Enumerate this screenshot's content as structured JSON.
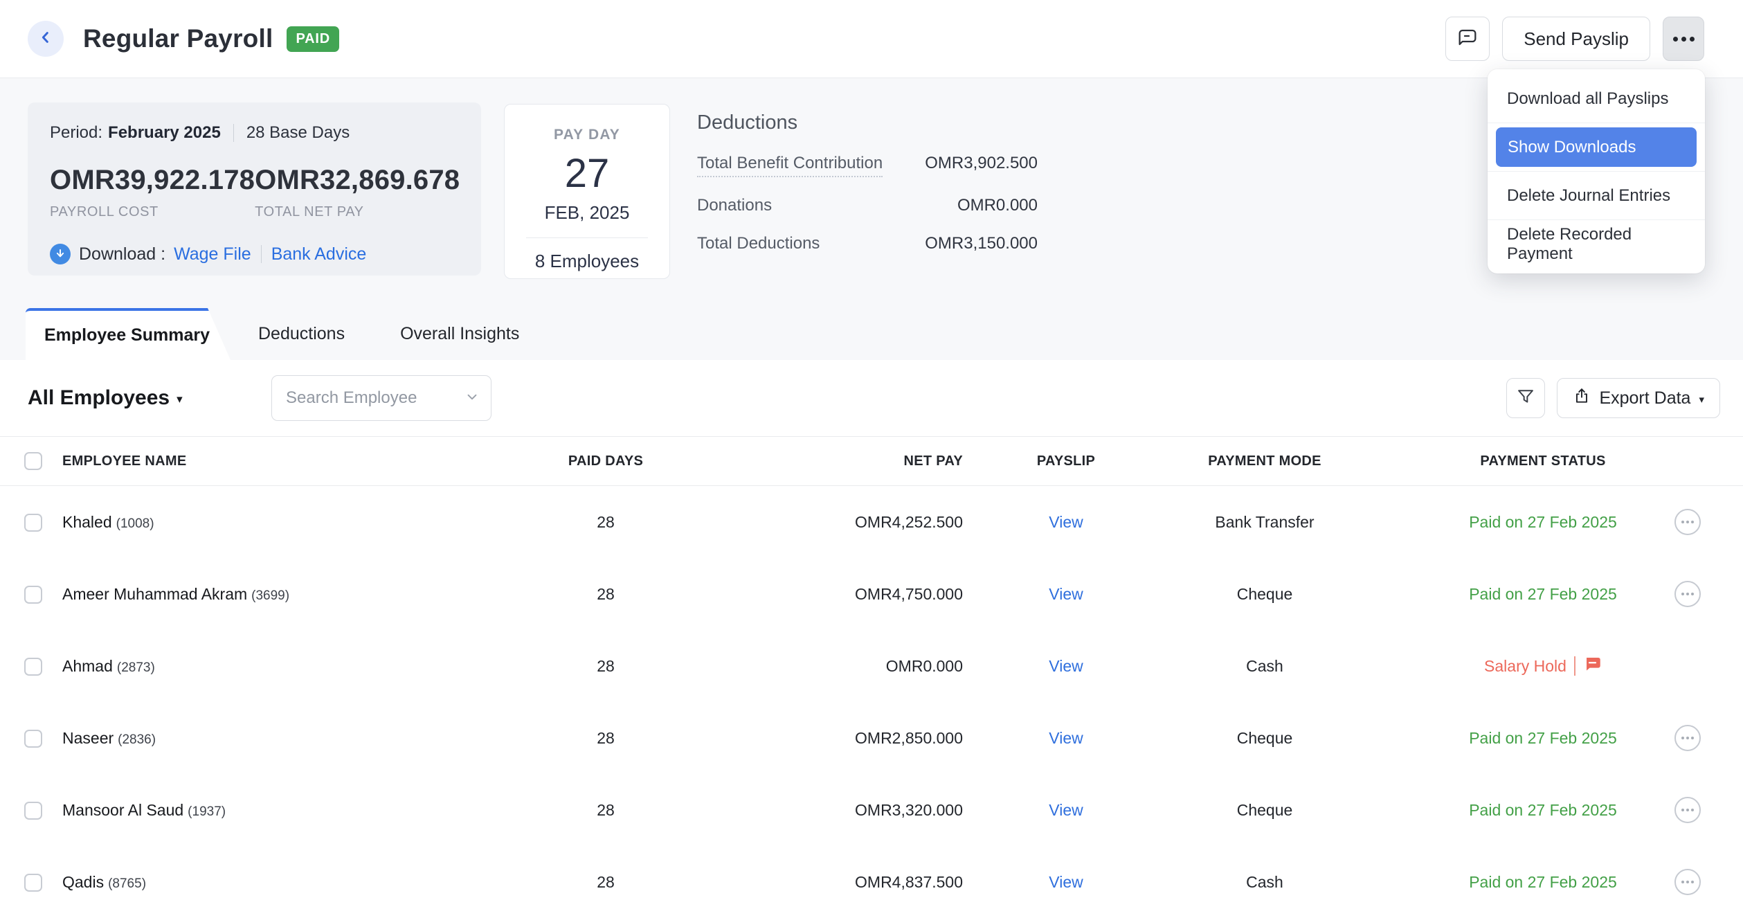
{
  "topbar": {
    "title": "Regular Payroll",
    "status_badge": "PAID",
    "send_payslip_label": "Send Payslip"
  },
  "menu": {
    "items": [
      {
        "label": "Download all Payslips",
        "highlighted": false
      },
      {
        "label": "Show Downloads",
        "highlighted": true
      },
      {
        "label": "Delete Journal Entries",
        "highlighted": false
      },
      {
        "label": "Delete Recorded Payment",
        "highlighted": false
      }
    ]
  },
  "summary": {
    "period_label": "Period:",
    "period_value": "February 2025",
    "base_days": "28 Base Days",
    "payroll_cost": "OMR39,922.178",
    "payroll_cost_label": "PAYROLL COST",
    "total_net_pay": "OMR32,869.678",
    "total_net_pay_label": "TOTAL NET PAY",
    "download_label": "Download :",
    "download_links": {
      "wage_file": "Wage File",
      "bank_advice": "Bank Advice"
    }
  },
  "payday": {
    "label": "PAY DAY",
    "day": "27",
    "month_year": "FEB, 2025",
    "employees": "8 Employees"
  },
  "deductions": {
    "title": "Deductions",
    "rows": [
      {
        "label": "Total Benefit Contribution",
        "value": "OMR3,902.500"
      },
      {
        "label": "Donations",
        "value": "OMR0.000"
      },
      {
        "label": "Total Deductions",
        "value": "OMR3,150.000"
      }
    ]
  },
  "tabs": [
    {
      "label": "Employee Summary",
      "active": true
    },
    {
      "label": "Deductions",
      "active": false
    },
    {
      "label": "Overall Insights",
      "active": false
    }
  ],
  "controls": {
    "employee_filter": "All Employees",
    "search_placeholder": "Search Employee",
    "export_label": "Export Data"
  },
  "table": {
    "headers": {
      "employee_name": "EMPLOYEE NAME",
      "paid_days": "PAID DAYS",
      "net_pay": "NET PAY",
      "payslip": "PAYSLIP",
      "payment_mode": "PAYMENT MODE",
      "payment_status": "PAYMENT STATUS"
    },
    "payslip_link_label": "View",
    "rows": [
      {
        "name": "Khaled",
        "id": "(1008)",
        "paid_days": "28",
        "net_pay": "OMR4,252.500",
        "mode": "Bank Transfer",
        "status": "Paid on 27 Feb 2025",
        "status_type": "paid"
      },
      {
        "name": "Ameer Muhammad Akram",
        "id": "(3699)",
        "paid_days": "28",
        "net_pay": "OMR4,750.000",
        "mode": "Cheque",
        "status": "Paid on 27 Feb 2025",
        "status_type": "paid"
      },
      {
        "name": "Ahmad",
        "id": "(2873)",
        "paid_days": "28",
        "net_pay": "OMR0.000",
        "mode": "Cash",
        "status": "Salary Hold",
        "status_type": "hold"
      },
      {
        "name": "Naseer",
        "id": "(2836)",
        "paid_days": "28",
        "net_pay": "OMR2,850.000",
        "mode": "Cheque",
        "status": "Paid on 27 Feb 2025",
        "status_type": "paid"
      },
      {
        "name": "Mansoor Al Saud",
        "id": "(1937)",
        "paid_days": "28",
        "net_pay": "OMR3,320.000",
        "mode": "Cheque",
        "status": "Paid on 27 Feb 2025",
        "status_type": "paid"
      },
      {
        "name": "Qadis",
        "id": "(8765)",
        "paid_days": "28",
        "net_pay": "OMR4,837.500",
        "mode": "Cash",
        "status": "Paid on 27 Feb 2025",
        "status_type": "paid"
      }
    ]
  },
  "icons": {
    "back": "chevron-left-circle",
    "comments": "speech-bubble-outline",
    "more": "ellipsis",
    "download": "arrow-down-in-blue-circle",
    "filter": "funnel",
    "export": "share-arrow-up",
    "dropdown_caret": "caret-down",
    "search_chevron": "chevron-down",
    "row_actions": "ellipsis-in-circle",
    "salary_hold_comment": "filled-chat-bubble"
  },
  "colors": {
    "accent_blue": "#2f6fdd",
    "menu_highlight_blue": "#5383e8",
    "badge_green": "#42a553",
    "status_paid_green": "#43a047",
    "status_hold_red": "#ec685a",
    "band_background": "#f7f8fa",
    "summary_card_background": "#eef0f4",
    "tab_indicator_blue": "#3b74e6"
  }
}
